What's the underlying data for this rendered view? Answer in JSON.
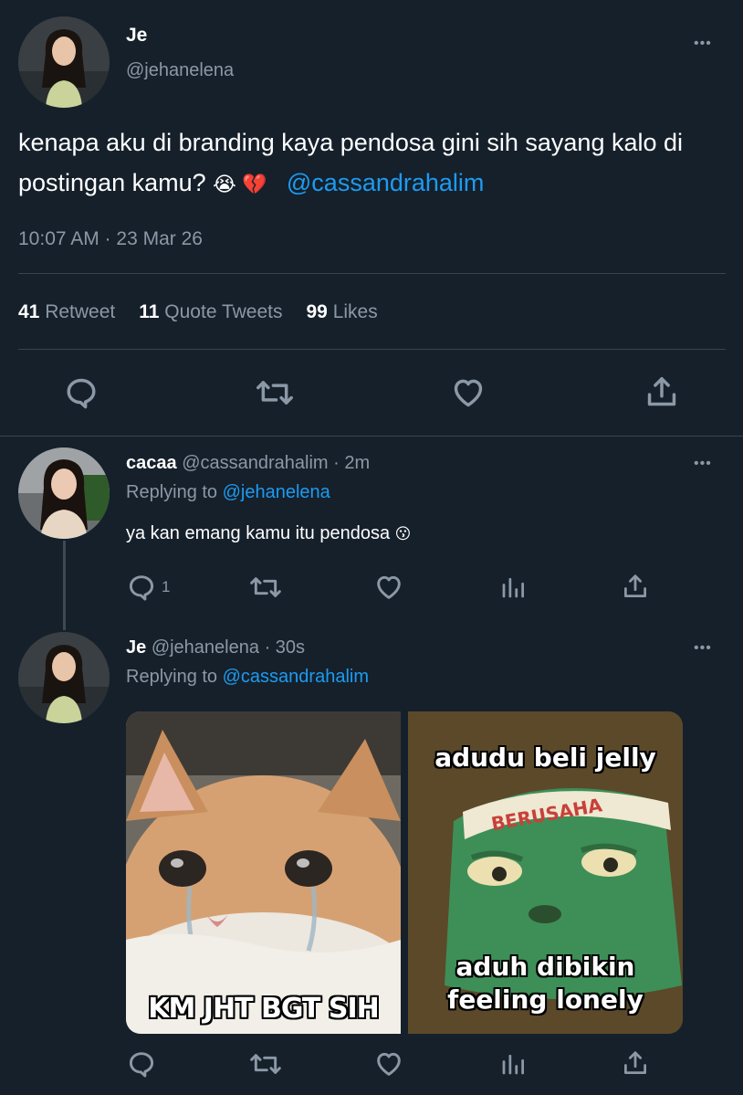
{
  "main_tweet": {
    "display_name": "Je",
    "handle": "@jehanelena",
    "text": "kenapa aku di branding kaya pendosa gini sih sayang kalo di postingan kamu?",
    "emojis": "😭 💔",
    "mention": "@cassandrahalim",
    "timestamp": "10:07 AM · 23 Mar 26",
    "stats": {
      "retweets_count": "41",
      "retweets_label": "Retweet",
      "quotes_count": "11",
      "quotes_label": "Quote Tweets",
      "likes_count": "99",
      "likes_label": "Likes"
    },
    "more_label": "•••"
  },
  "reply1": {
    "display_name": "cacaa",
    "handle": "@cassandrahalim",
    "time": "· 2m",
    "replying_label": "Replying to",
    "replying_handle": "@jehanelena",
    "text": "ya kan emang kamu itu pendosa",
    "emoji": "😗",
    "reply_count": "1",
    "more_label": "•••"
  },
  "reply2": {
    "display_name": "Je",
    "handle": "@jehanelena",
    "time": "· 30s",
    "replying_label": "Replying to",
    "replying_handle": "@cassandrahalim",
    "more_label": "•••",
    "meme_left_caption": "KM JHT BGT SIH",
    "meme_right_top": "adudu beli jelly",
    "meme_right_bottom": "aduh dibikin feeling lonely",
    "headband_text": "BERUSAHA"
  },
  "colors": {
    "background": "#15202b",
    "link": "#1d9bf0",
    "muted": "#8b98a5",
    "divider": "#38444d"
  }
}
